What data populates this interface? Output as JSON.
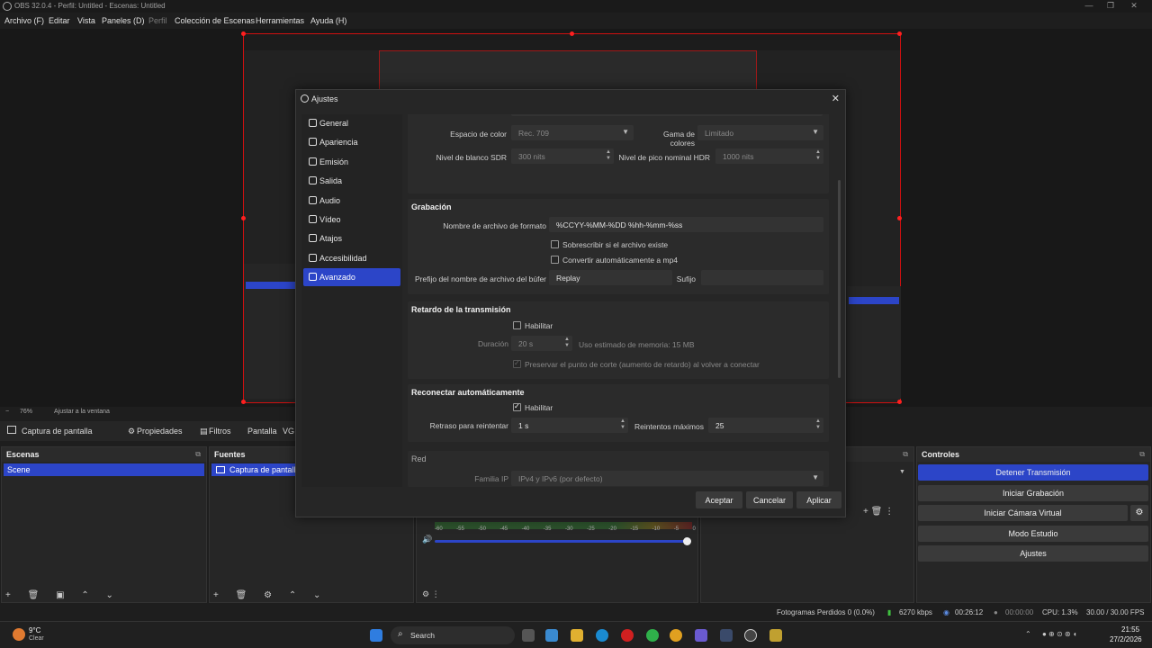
{
  "window": {
    "title": "OBS 32.0.4 - Perfil: Untitled - Escenas: Untitled"
  },
  "menubar": {
    "items": [
      "Archivo (F)",
      "Editar",
      "Vista",
      "Paneles (D)",
      "Perfil",
      "Colección de Escenas",
      "Herramientas",
      "Ayuda (H)"
    ]
  },
  "preview": {
    "zoom": "76%",
    "fit_label": "Ajustar a la ventana"
  },
  "source_toolbar": {
    "source": "Captura de pantalla",
    "properties": "Propiedades",
    "filters": "Filtros",
    "display": "Pantalla",
    "trunc": "VG"
  },
  "docks": {
    "scenes": {
      "title": "Escenas",
      "items": [
        "Scene"
      ]
    },
    "sources": {
      "title": "Fuentes",
      "items": [
        "Captura de pantalla"
      ]
    },
    "controls": {
      "title": "Controles",
      "buttons": [
        "Detener Transmisión",
        "Iniciar Grabación",
        "Iniciar Cámara Virtual",
        "Modo Estudio",
        "Ajustes"
      ]
    }
  },
  "mixer": {
    "ticks": [
      "-60",
      "-55",
      "-50",
      "-45",
      "-40",
      "-35",
      "-30",
      "-25",
      "-20",
      "-15",
      "-10",
      "-5",
      "0"
    ]
  },
  "statusbar": {
    "dropped": "Fotogramas Perdidos 0 (0.0%)",
    "bitrate": "6270 kbps",
    "stream_time": "00:26:12",
    "rec_time": "00:00:00",
    "cpu": "CPU: 1.3%",
    "fps": "30.00 / 30.00 FPS"
  },
  "taskbar": {
    "weather_temp": "9°C",
    "weather_desc": "Clear",
    "search": "Search",
    "time": "21:55",
    "date": "27/2/2026"
  },
  "dialog": {
    "title": "Ajustes",
    "nav": [
      "General",
      "Apariencia",
      "Emisión",
      "Salida",
      "Audio",
      "Vídeo",
      "Atajos",
      "Accesibilidad",
      "Avanzado"
    ],
    "selected_nav": "Avanzado",
    "video": {
      "color_space_label": "Espacio de color",
      "color_space": "Rec. 709",
      "color_range_label": "Gama de colores",
      "color_range": "Limitado",
      "sdr_white_label": "Nivel de blanco SDR",
      "sdr_white": "300 nits",
      "hdr_peak_label": "Nivel de pico nominal HDR",
      "hdr_peak": "1000 nits"
    },
    "recording": {
      "title": "Grabación",
      "filename_format_label": "Nombre de archivo de formato",
      "filename_format": "%CCYY-%MM-%DD %hh-%mm-%ss",
      "overwrite_label": "Sobrescribir si el archivo existe",
      "remux_label": "Convertir automáticamente a mp4",
      "prefix_label": "Prefijo del nombre de archivo del búfer",
      "prefix": "Replay",
      "suffix_label": "Sufijo",
      "suffix": ""
    },
    "stream_delay": {
      "title": "Retardo de la transmisión",
      "enable_label": "Habilitar",
      "duration_label": "Duración",
      "duration": "20 s",
      "memory_estimate": "Uso estimado de memoria: 15 MB",
      "preserve_label": "Preservar el punto de corte (aumento de retardo) al volver a conectar"
    },
    "reconnect": {
      "title": "Reconectar automáticamente",
      "enable_label": "Habilitar",
      "retry_delay_label": "Retraso para reintentar",
      "retry_delay": "1 s",
      "max_retries_label": "Reintentos máximos",
      "max_retries": "25"
    },
    "network": {
      "title": "Red",
      "ip_family_label": "Familia IP",
      "ip_family": "IPv4 y IPv6 (por defecto)"
    },
    "buttons": {
      "accept": "Aceptar",
      "cancel": "Cancelar",
      "apply": "Aplicar"
    }
  },
  "colors": {
    "accent": "#2c45c8",
    "preview_border": "#d01010"
  }
}
